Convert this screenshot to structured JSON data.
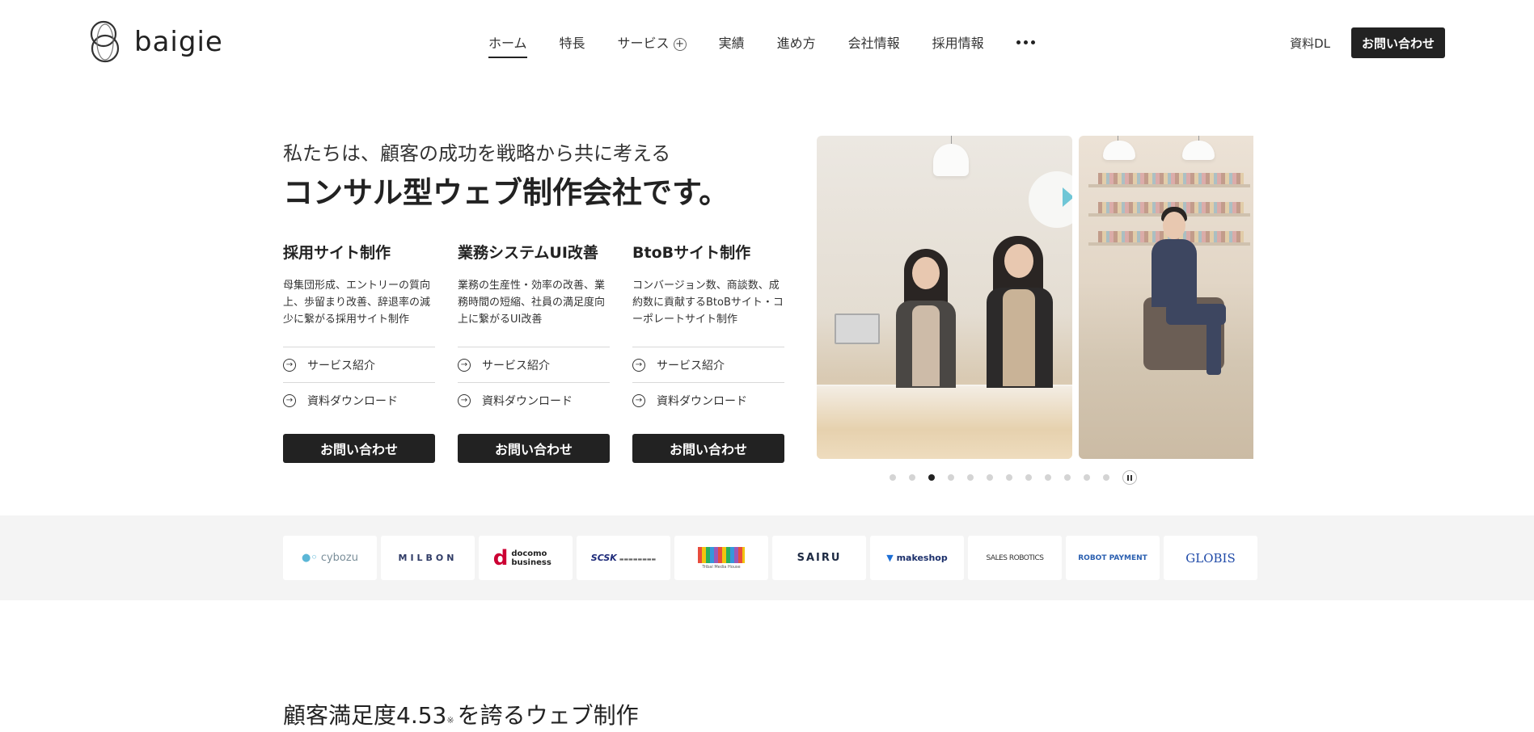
{
  "brand": {
    "name": "baigie"
  },
  "nav": {
    "items": [
      {
        "label": "ホーム",
        "active": true
      },
      {
        "label": "特長"
      },
      {
        "label": "サービス",
        "expandable": true
      },
      {
        "label": "実績"
      },
      {
        "label": "進め方"
      },
      {
        "label": "会社情報"
      },
      {
        "label": "採用情報"
      }
    ],
    "more_icon": "more-horizontal-icon"
  },
  "header_actions": {
    "doc_download": "資料DL",
    "contact": "お問い合わせ"
  },
  "hero": {
    "subtitle": "私たちは、顧客の成功を戦略から共に考える",
    "title": "コンサル型ウェブ制作会社です。"
  },
  "services": [
    {
      "title": "採用サイト制作",
      "description": "母集団形成、エントリーの質向上、歩留まり改善、辞退率の減少に繋がる採用サイト制作",
      "link_service": "サービス紹介",
      "link_download": "資料ダウンロード",
      "cta": "お問い合わせ"
    },
    {
      "title": "業務システムUI改善",
      "description": "業務の生産性・効率の改善、業務時間の短縮、社員の満足度向上に繋がるUI改善",
      "link_service": "サービス紹介",
      "link_download": "資料ダウンロード",
      "cta": "お問い合わせ"
    },
    {
      "title": "BtoBサイト制作",
      "description": "コンバージョン数、商談数、成約数に貢献するBtoBサイト・コーポレートサイト制作",
      "link_service": "サービス紹介",
      "link_download": "資料ダウンロード",
      "cta": "お問い合わせ"
    }
  ],
  "carousel": {
    "slide_count": 12,
    "active_index": 2,
    "state": "playing"
  },
  "clients": [
    {
      "name": "cybozu",
      "color": "#7a8e99"
    },
    {
      "name": "MILBON",
      "color": "#2f3b66"
    },
    {
      "name": "docomo business",
      "color": "#cc0033"
    },
    {
      "name": "SCSK",
      "color": "#1e2b7a"
    },
    {
      "name": "Tribal Media House",
      "color": "#555555"
    },
    {
      "name": "SAIRU",
      "color": "#1e2b44"
    },
    {
      "name": "makeshop",
      "color": "#1b2f6b"
    },
    {
      "name": "SALES ROBOTICS",
      "color": "#333333"
    },
    {
      "name": "ROBOT PAYMENT",
      "color": "#2a5fb0"
    },
    {
      "name": "GLOBIS",
      "color": "#1f4aa8"
    }
  ],
  "section": {
    "title_main": "顧客満足度4.53",
    "note": "※",
    "title_rest": "を誇るウェブ制作"
  },
  "colors": {
    "primary": "#222222",
    "band": "#f4f4f4",
    "border": "#d8d8d8"
  }
}
